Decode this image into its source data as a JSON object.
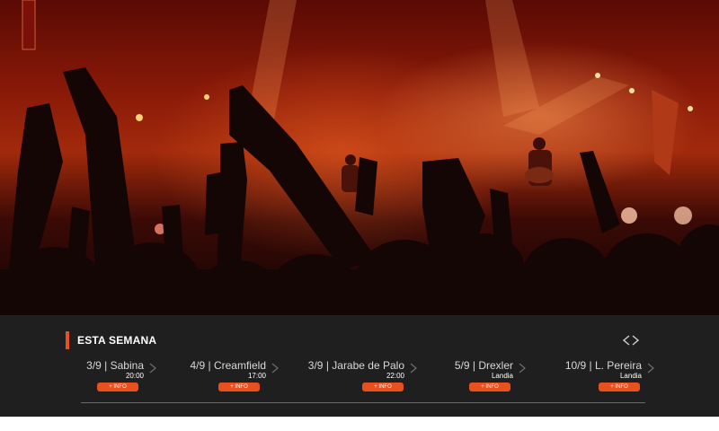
{
  "section": {
    "title": "ESTA SEMANA"
  },
  "nav": {
    "icon": "prev-next-arrows-icon"
  },
  "events": [
    {
      "name": "3/9 | Sabina",
      "time": "20:00",
      "venue": "",
      "button": "+ INFO"
    },
    {
      "name": "4/9 | Creamfield",
      "time": "17:00",
      "venue": "",
      "button": "+ INFO"
    },
    {
      "name": "3/9 | Jarabe de Palo",
      "time": "22:00",
      "venue": "",
      "button": "+ INFO"
    },
    {
      "name": "5/9 | Drexler",
      "time": "",
      "venue": "Landia",
      "button": "+ INFO"
    },
    {
      "name": "10/9 | L. Pereira",
      "time": "",
      "venue": "Landia",
      "button": "+ INFO"
    }
  ],
  "colors": {
    "accent": "#e8511e",
    "bar_background": "#1f1f1f"
  }
}
